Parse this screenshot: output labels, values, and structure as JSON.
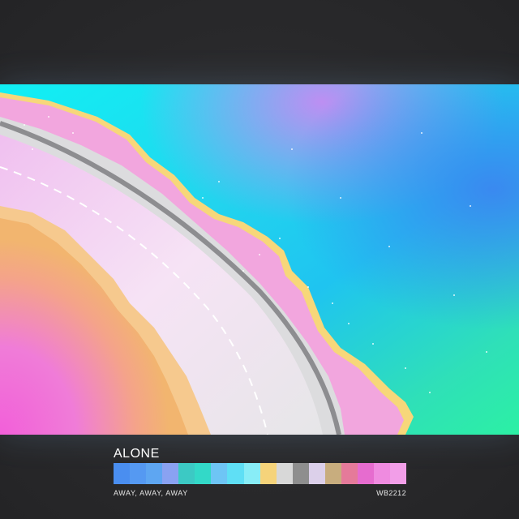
{
  "poster": {
    "title": "ALONE",
    "subtitle": "AWAY, AWAY, AWAY",
    "code": "WB2212"
  },
  "colors": {
    "background": "#2b2b2d",
    "text": "#ffffff"
  },
  "palette": [
    "#4a8ef0",
    "#5599f2",
    "#5ea6f2",
    "#8aa2f2",
    "#3cc9c4",
    "#33d9c8",
    "#6ec5f5",
    "#5fdff5",
    "#88edf7",
    "#f5d37a",
    "#d8d8d8",
    "#8e8e8e",
    "#dcd0ea",
    "#c8ad7e",
    "#e57a9a",
    "#e66ccf",
    "#ef8be0",
    "#f29ee8"
  ]
}
